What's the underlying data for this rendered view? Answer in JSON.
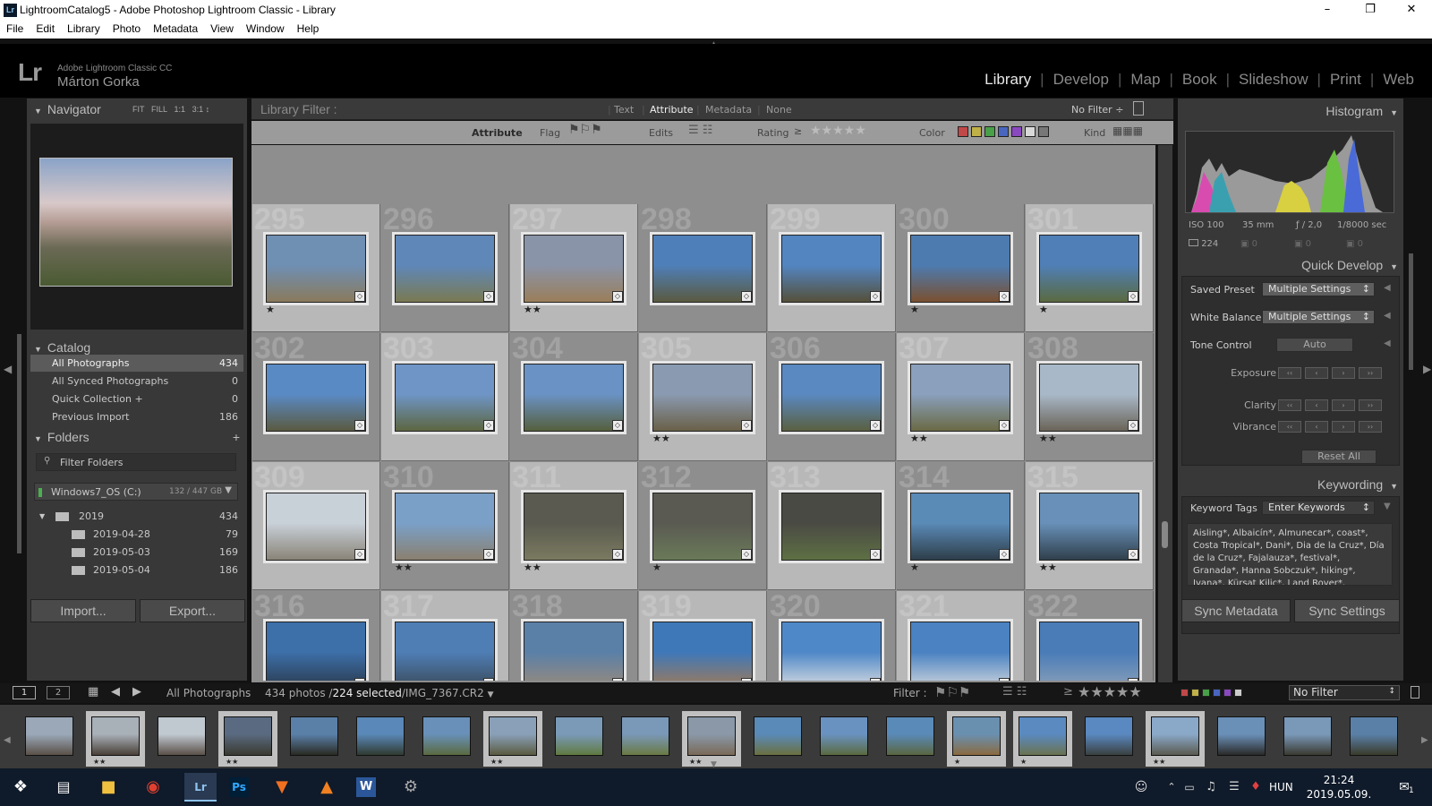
{
  "window": {
    "title": "LightroomCatalog5 - Adobe Photoshop Lightroom Classic - Library",
    "app_icon": "Lr"
  },
  "menu": [
    "File",
    "Edit",
    "Library",
    "Photo",
    "Metadata",
    "View",
    "Window",
    "Help"
  ],
  "identity": {
    "logo": "Lr",
    "product": "Adobe Lightroom Classic CC",
    "user": "Márton Gorka"
  },
  "modules": [
    "Library",
    "Develop",
    "Map",
    "Book",
    "Slideshow",
    "Print",
    "Web"
  ],
  "navigator": {
    "title": "Navigator",
    "zoom": [
      "FIT",
      "FILL",
      "1:1",
      "3:1"
    ]
  },
  "catalog": {
    "title": "Catalog",
    "items": [
      {
        "label": "All Photographs",
        "count": "434"
      },
      {
        "label": "All Synced Photographs",
        "count": "0"
      },
      {
        "label": "Quick Collection +",
        "count": "0"
      },
      {
        "label": "Previous Import",
        "count": "186"
      }
    ]
  },
  "folders": {
    "title": "Folders",
    "filter_placeholder": "Filter Folders",
    "volume": {
      "label": "Windows7_OS (C:)",
      "space": "132 / 447 GB"
    },
    "items": [
      {
        "label": "2019",
        "count": "434"
      },
      {
        "label": "2019-04-28",
        "count": "79"
      },
      {
        "label": "2019-05-03",
        "count": "169"
      },
      {
        "label": "2019-05-04",
        "count": "186"
      }
    ]
  },
  "left_buttons": {
    "import": "Import...",
    "export": "Export..."
  },
  "library_filter": {
    "label": "Library Filter :",
    "tabs": [
      "Text",
      "Attribute",
      "Metadata",
      "None"
    ],
    "preset": "No Filter ÷",
    "attr_label": "Attribute",
    "flag": "Flag",
    "edits": "Edits",
    "rating": "Rating",
    "rating_op": "≥",
    "color": "Color",
    "kind": "Kind"
  },
  "grid": {
    "cells": [
      {
        "n": "295",
        "stars": "★",
        "c1": "#6f8fb3",
        "c2": "#8a7a5c"
      },
      {
        "n": "296",
        "stars": "",
        "c1": "#5f87b8",
        "c2": "#7a7a52"
      },
      {
        "n": "297",
        "stars": "★★",
        "c1": "#8a94a8",
        "c2": "#9a7e5a"
      },
      {
        "n": "298",
        "stars": "",
        "c1": "#4f7fb8",
        "c2": "#5a5a40"
      },
      {
        "n": "299",
        "stars": "",
        "c1": "#5385c0",
        "c2": "#55503a"
      },
      {
        "n": "300",
        "stars": "★",
        "c1": "#4d7bb0",
        "c2": "#7a5030"
      },
      {
        "n": "301",
        "stars": "★",
        "c1": "#4f7fb6",
        "c2": "#5a6a40"
      },
      {
        "n": "302",
        "stars": "",
        "c1": "#5a8ac4",
        "c2": "#5a5a40"
      },
      {
        "n": "303",
        "stars": "",
        "c1": "#6e95c6",
        "c2": "#5d6640"
      },
      {
        "n": "304",
        "stars": "",
        "c1": "#6a92c4",
        "c2": "#56603e"
      },
      {
        "n": "305",
        "stars": "★★",
        "c1": "#8a9ab0",
        "c2": "#6a6048"
      },
      {
        "n": "306",
        "stars": "",
        "c1": "#5a88c0",
        "c2": "#5a6040"
      },
      {
        "n": "307",
        "stars": "★★",
        "c1": "#8aa0bc",
        "c2": "#6a6a44"
      },
      {
        "n": "308",
        "stars": "★★",
        "c1": "#a9b8c8",
        "c2": "#6a6458"
      },
      {
        "n": "309",
        "stars": "",
        "c1": "#c8d0d8",
        "c2": "#8a8478"
      },
      {
        "n": "310",
        "stars": "★★",
        "c1": "#7aa0c8",
        "c2": "#8a8070"
      },
      {
        "n": "311",
        "stars": "★★",
        "c1": "#5a5a50",
        "c2": "#7a7a60"
      },
      {
        "n": "312",
        "stars": "★",
        "c1": "#5a5a52",
        "c2": "#6a7a58"
      },
      {
        "n": "313",
        "stars": "",
        "c1": "#4a4a44",
        "c2": "#5e7044"
      },
      {
        "n": "314",
        "stars": "★",
        "c1": "#5a8ab6",
        "c2": "#2e3e4a"
      },
      {
        "n": "315",
        "stars": "★★",
        "c1": "#6890b8",
        "c2": "#30404c"
      },
      {
        "n": "316",
        "stars": "",
        "c1": "#3d6fa8",
        "c2": "#2a3a4e"
      },
      {
        "n": "317",
        "stars": "",
        "c1": "#4f7eb5",
        "c2": "#3a4a5a"
      },
      {
        "n": "318",
        "stars": "",
        "c1": "#5a80a8",
        "c2": "#9a8a7a"
      },
      {
        "n": "319",
        "stars": "",
        "c1": "#3f78b8",
        "c2": "#a07a58"
      },
      {
        "n": "320",
        "stars": "",
        "c1": "#4f88c8",
        "c2": "#d8dce0"
      },
      {
        "n": "321",
        "stars": "",
        "c1": "#4a82c2",
        "c2": "#d0d6dc"
      },
      {
        "n": "322",
        "stars": "",
        "c1": "#4a7cb8",
        "c2": "#8aa0b8"
      }
    ]
  },
  "histogram": {
    "title": "Histogram",
    "iso": "ISO 100",
    "focal": "35 mm",
    "aperture": "ƒ / 2,0",
    "shutter": "1/8000 sec",
    "photos": "224",
    "z1": "0",
    "z2": "0",
    "z3": "0"
  },
  "quick_develop": {
    "title": "Quick Develop",
    "saved_preset_label": "Saved Preset",
    "saved_preset_value": "Multiple Settings",
    "wb_label": "White Balance",
    "wb_value": "Multiple Settings",
    "tone_label": "Tone Control",
    "tone_value": "Auto",
    "exposure": "Exposure",
    "clarity": "Clarity",
    "vibrance": "Vibrance",
    "reset": "Reset All"
  },
  "keywording": {
    "title": "Keywording",
    "tags_label": "Keyword Tags",
    "tags_value": "Enter Keywords",
    "keywords": "Aisling*, Albaicín*, Almunecar*, coast*, Costa Tropical*, Dani*, Dia de la Cruz*, Día de la Cruz*, Fajalauza*, festival*, Granada*, Hanna Sobczuk*, hiking*, Ivana*, Kürsat Kilic*, Land Rover*, landscape*, Las"
  },
  "right_buttons": {
    "sync_metadata": "Sync Metadata",
    "sync_settings": "Sync Settings"
  },
  "filmstrip_bar": {
    "page1": "1",
    "page2": "2",
    "source": "All Photographs",
    "count_prefix": "434 photos /",
    "selected": "224 selected",
    "file": "/IMG_7367.CR2",
    "filter": "Filter :",
    "rating_op": "≥",
    "preset": "No Filter"
  },
  "filmstrip": [
    {
      "c1": "#9aa8b8",
      "c2": "#5a5048",
      "stars": ""
    },
    {
      "c1": "#a8b0b8",
      "c2": "#4a4038",
      "stars": "★★"
    },
    {
      "c1": "#c0c8d0",
      "c2": "#5a5048",
      "stars": ""
    },
    {
      "c1": "#5a6a80",
      "c2": "#3a3a30",
      "stars": "★★"
    },
    {
      "c1": "#5a80a8",
      "c2": "#2a2a22",
      "stars": ""
    },
    {
      "c1": "#5a88b8",
      "c2": "#303a30",
      "stars": ""
    },
    {
      "c1": "#6890b8",
      "c2": "#5a6a40",
      "stars": ""
    },
    {
      "c1": "#8aa0b8",
      "c2": "#5a5a40",
      "stars": "★★"
    },
    {
      "c1": "#7a9ab8",
      "c2": "#607a40",
      "stars": ""
    },
    {
      "c1": "#7a98b8",
      "c2": "#6a7a44",
      "stars": ""
    },
    {
      "c1": "#8a98a8",
      "c2": "#7a6a58",
      "stars": "★★"
    },
    {
      "c1": "#5a8ab8",
      "c2": "#6a7040",
      "stars": ""
    },
    {
      "c1": "#6a92c0",
      "c2": "#5a6a40",
      "stars": ""
    },
    {
      "c1": "#5a8ab8",
      "c2": "#5a6640",
      "stars": ""
    },
    {
      "c1": "#6a90b0",
      "c2": "#8a6a40",
      "stars": "★"
    },
    {
      "c1": "#5a8ac0",
      "c2": "#6a7250",
      "stars": "★"
    },
    {
      "c1": "#5a88c0",
      "c2": "#3a4040",
      "stars": ""
    },
    {
      "c1": "#8aa8c8",
      "c2": "#5a5a50",
      "stars": "★★"
    },
    {
      "c1": "#6a90b8",
      "c2": "#2a2a28",
      "stars": ""
    },
    {
      "c1": "#7a98b8",
      "c2": "#3a3a30",
      "stars": ""
    },
    {
      "c1": "#5a80a8",
      "c2": "#3a3a2a",
      "stars": ""
    }
  ],
  "taskbar": {
    "lang": "HUN",
    "time": "21:24",
    "date": "2019.05.09.",
    "notif": "1"
  },
  "colors": {
    "accent": "#e8e8e8",
    "panel": "#383838",
    "grid_bg": "#8e8e8e"
  }
}
